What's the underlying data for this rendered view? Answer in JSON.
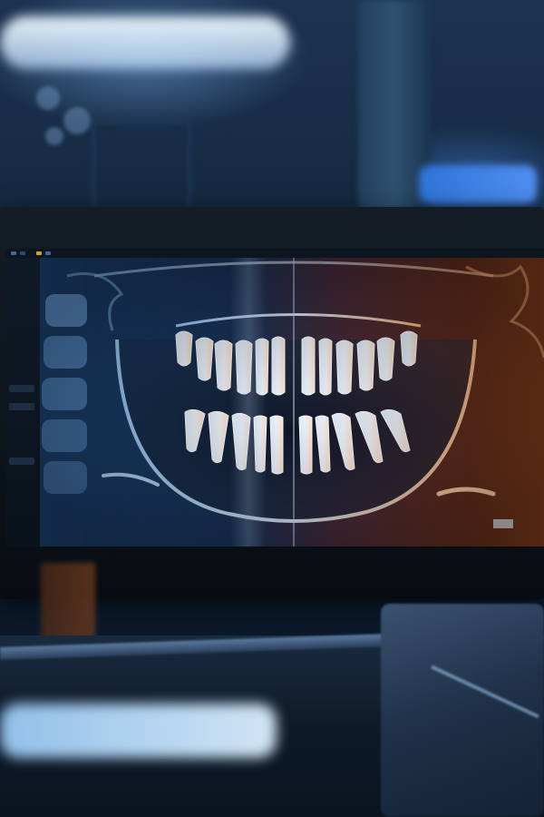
{
  "scene": {
    "description_colors": {
      "background": "#0d1c2f",
      "xray_cool": "#5aa8ff",
      "xray_warm": "#ff8a3d",
      "tooth": "#e8f2ff",
      "ui_accent": "#e0a020"
    },
    "icons": {
      "monitor": "monitor-icon",
      "xray": "panoramic-dental-xray"
    }
  }
}
